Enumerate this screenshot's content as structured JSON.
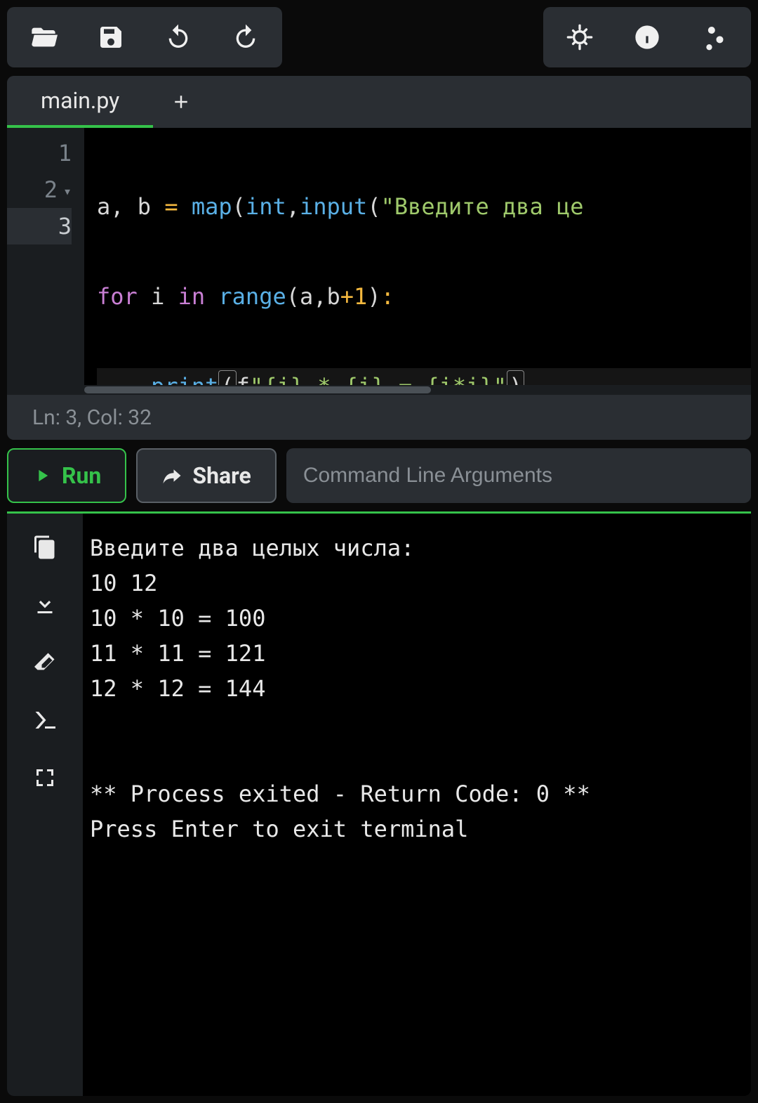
{
  "toolbar": {
    "left_icons": [
      "folder-open-icon",
      "save-icon",
      "undo-icon",
      "redo-icon"
    ],
    "right_icons": [
      "theme-icon",
      "info-icon",
      "settings-icon"
    ]
  },
  "tabs": {
    "active": {
      "label": "main.py"
    }
  },
  "editor": {
    "gutter": [
      "1",
      "2",
      "3"
    ],
    "lines": {
      "l1": {
        "ids": "a, b ",
        "eq": "= ",
        "map": "map",
        "p1": "(",
        "int": "int",
        "c1": ",",
        "input": "input",
        "p2": "(",
        "str": "\"Введите два це"
      },
      "l2": {
        "for": "for",
        "sp1": " ",
        "i": "i",
        "sp2": " ",
        "in": "in",
        "sp3": " ",
        "range": "range",
        "p1": "(",
        "a": "a",
        "c": ",",
        "b": "b",
        "plus": "+",
        "one": "1",
        "p2": ")",
        "colon": ":"
      },
      "l3": {
        "indent": "    ",
        "print": "print",
        "p1": "(",
        "f": "f",
        "str": "\"{i} * {i} = {i*i}\"",
        "p2": ")"
      }
    }
  },
  "status": {
    "text": "Ln: 3,  Col: 32"
  },
  "actions": {
    "run": "Run",
    "share": "Share",
    "args_placeholder": "Command Line Arguments"
  },
  "terminal": {
    "lines": [
      "Введите два целых числа:",
      "10 12",
      "10 * 10 = 100",
      "11 * 11 = 121",
      "12 * 12 = 144",
      "",
      "",
      "** Process exited - Return Code: 0 **",
      "Press Enter to exit terminal"
    ]
  }
}
